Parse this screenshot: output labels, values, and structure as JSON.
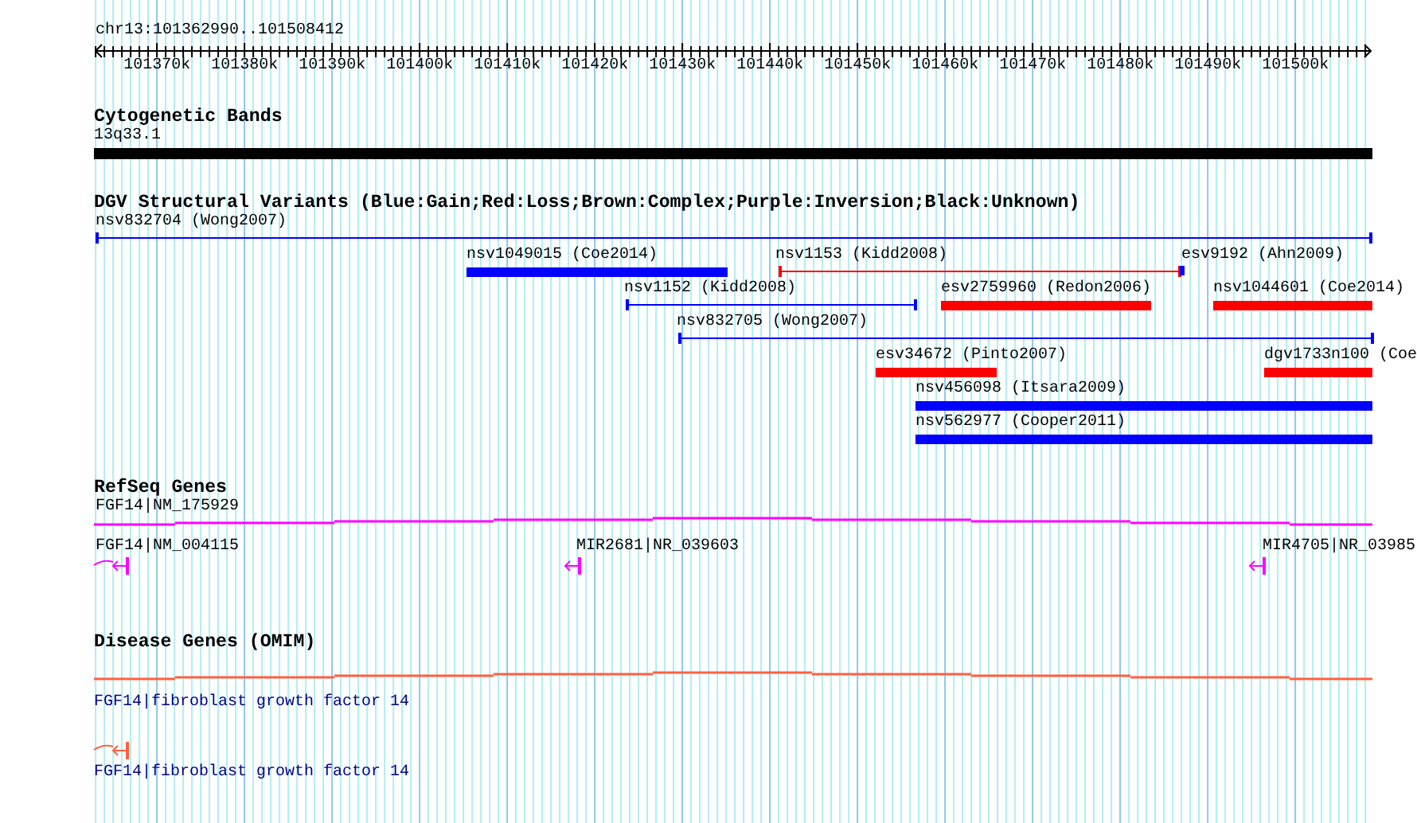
{
  "locus": "chr13:101362990..101508412",
  "ticks": [
    "101370k",
    "101380k",
    "101390k",
    "101400k",
    "101410k",
    "101420k",
    "101430k",
    "101440k",
    "101450k",
    "101460k",
    "101470k",
    "101480k",
    "101490k",
    "101500k"
  ],
  "tracks": [
    {
      "kind": "bands",
      "title": "Cytogenetic Bands",
      "features": [
        {
          "label": "13q33.1"
        }
      ]
    },
    {
      "kind": "variants",
      "title": "DGV Structural Variants (Blue:Gain;Red:Loss;Brown:Complex;Purple:Inversion;Black:Unknown)",
      "features": [
        {
          "label": "nsv832704 (Wong2007)",
          "kind": "line",
          "color": "#0000ff"
        },
        {
          "label": "nsv1049015 (Coe2014)",
          "kind": "bar",
          "color": "#0000ff"
        },
        {
          "label": "nsv1153 (Kidd2008)",
          "kind": "line",
          "color": "#ff0000"
        },
        {
          "label": "esv9192 (Ahn2009)",
          "kind": "bar",
          "color": "#0000ff"
        },
        {
          "label": "nsv1152 (Kidd2008)",
          "kind": "line",
          "color": "#0000ff"
        },
        {
          "label": "esv2759960 (Redon2006)",
          "kind": "bar",
          "color": "#ff0000"
        },
        {
          "label": "nsv1044601 (Coe2014)",
          "kind": "bar",
          "color": "#ff0000"
        },
        {
          "label": "nsv832705 (Wong2007)",
          "kind": "line",
          "color": "#0000ff"
        },
        {
          "label": "esv34672 (Pinto2007)",
          "kind": "bar",
          "color": "#ff0000"
        },
        {
          "label": "dgv1733n100 (Coe",
          "kind": "bar",
          "color": "#ff0000"
        },
        {
          "label": "nsv456098 (Itsara2009)",
          "kind": "bar",
          "color": "#0000ff"
        },
        {
          "label": "nsv562977 (Cooper2011)",
          "kind": "bar",
          "color": "#0000ff"
        }
      ]
    },
    {
      "kind": "genes",
      "title": "RefSeq Genes",
      "features": [
        {
          "label": "FGF14|NM_175929",
          "kind": "span"
        },
        {
          "label": "FGF14|NM_004115",
          "kind": "curved-arrow"
        },
        {
          "label": "MIR2681|NR_039603",
          "kind": "arrow"
        },
        {
          "label": "MIR4705|NR_03985",
          "kind": "arrow"
        }
      ]
    },
    {
      "kind": "disease",
      "title": "Disease Genes (OMIM)",
      "features": [
        {
          "label": "FGF14|fibroblast growth factor 14",
          "kind": "span"
        },
        {
          "label": "FGF14|fibroblast growth factor 14",
          "kind": "curved-arrow"
        }
      ]
    }
  ]
}
